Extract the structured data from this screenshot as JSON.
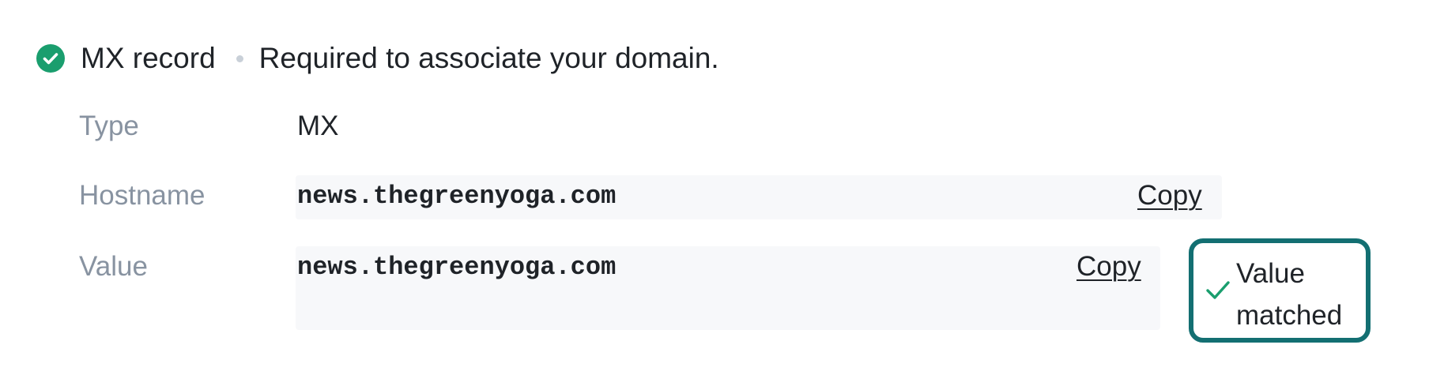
{
  "record": {
    "name": "MX record",
    "description": "Required to associate your domain.",
    "status_icon": "check-circle-icon",
    "status_color": "#1a9e6e"
  },
  "fields": {
    "type": {
      "label": "Type",
      "value": "MX"
    },
    "hostname": {
      "label": "Hostname",
      "value": "news.thegreenyoga.com",
      "copy_label": "Copy"
    },
    "value": {
      "label": "Value",
      "value": "news.thegreenyoga.com",
      "copy_label": "Copy"
    }
  },
  "match_badge": {
    "text": "Value matched",
    "icon": "checkmark-icon",
    "border_color": "#136f72",
    "check_color": "#1a9e6e"
  }
}
